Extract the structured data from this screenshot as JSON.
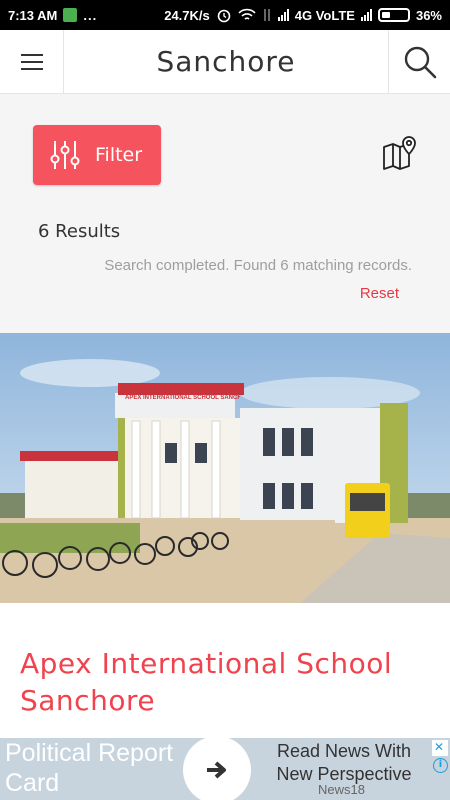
{
  "status_bar": {
    "time": "7:13 AM",
    "dots": "...",
    "network_speed": "24.7K/s",
    "network_type": "4G VoLTE",
    "battery": "36%"
  },
  "header": {
    "title": "Sanchore",
    "menu_icon": "hamburger-icon",
    "search_icon": "search-icon"
  },
  "filter_panel": {
    "filter_label": "Filter",
    "filter_icon": "sliders-icon",
    "map_icon": "map-pin-icon",
    "results_count": "6 Results",
    "search_status": "Search completed. Found 6 matching records.",
    "reset_label": "Reset",
    "accent_color": "#f5535d"
  },
  "listing": {
    "photo_sign_text": "APEX INTERNATIONAL SCHOOL SANCHORE",
    "name": "Apex International School Sanchore",
    "name_color": "#f0434e"
  },
  "ad": {
    "headline": "Political Report Card",
    "tagline": "Read News With New Perspective",
    "source": "News18",
    "close_label": "✕",
    "info_label": "i"
  }
}
